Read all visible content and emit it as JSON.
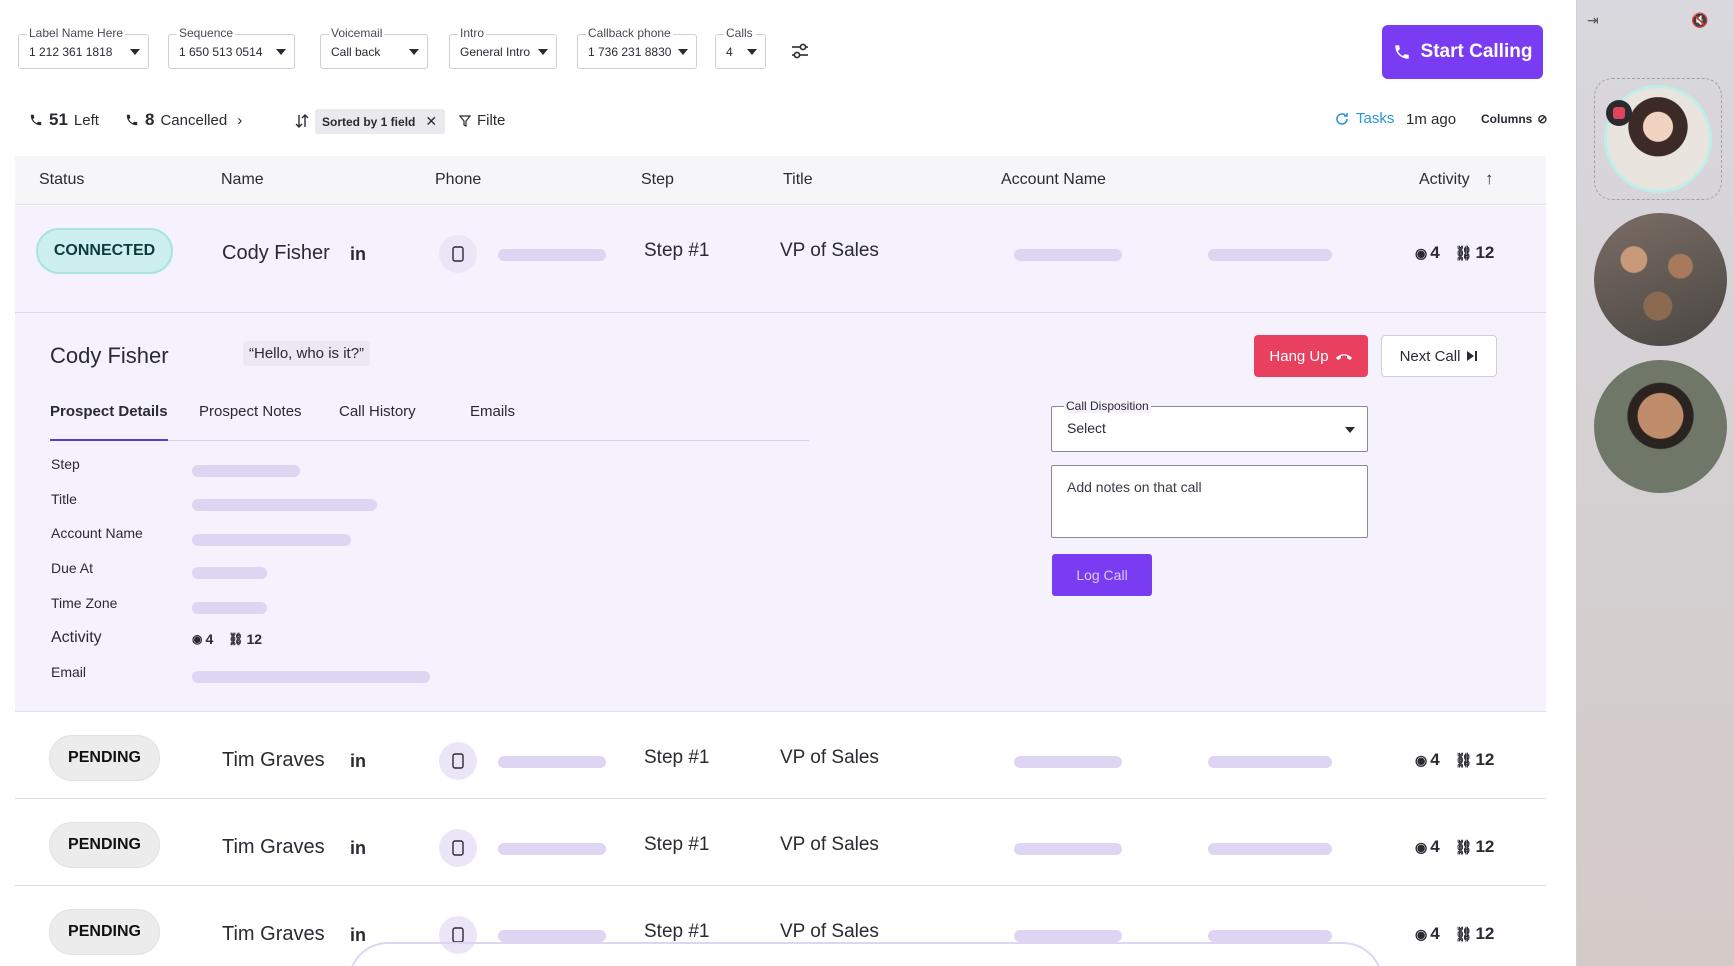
{
  "filters": [
    {
      "label": "Label Name Here",
      "value": "1 212 361 1818"
    },
    {
      "label": "Sequence",
      "value": "1 650 513 0514"
    },
    {
      "label": "Voicemail",
      "value": "Call back"
    },
    {
      "label": "Intro",
      "value": "General Intro"
    },
    {
      "label": "Callback phone",
      "value": "1 736 231 8830"
    },
    {
      "label": "Calls",
      "value": "4"
    }
  ],
  "start_button": "Start Calling",
  "stats": {
    "left_count": "51",
    "left_label": "Left",
    "cancelled_count": "8",
    "cancelled_label": "Cancelled",
    "sort_chip": "Sorted by 1 field",
    "filter_label": "Filte",
    "tasks_label": "Tasks",
    "updated": "1m ago",
    "columns_label": "Columns"
  },
  "table": {
    "headers": [
      "Status",
      "Name",
      "Phone",
      "Step",
      "Title",
      "Account Name",
      "Activity"
    ],
    "rows": [
      {
        "status": "CONNECTED",
        "name": "Cody Fisher",
        "linkedin": "in",
        "step": "Step #1",
        "title": "VP of Sales",
        "views": "4",
        "links": "12"
      },
      {
        "status": "PENDING",
        "name": "Tim Graves",
        "linkedin": "in",
        "step": "Step #1",
        "title": "VP of Sales",
        "views": "4",
        "links": "12"
      },
      {
        "status": "PENDING",
        "name": "Tim Graves",
        "linkedin": "in",
        "step": "Step #1",
        "title": "VP of Sales",
        "views": "4",
        "links": "12"
      },
      {
        "status": "PENDING",
        "name": "Tim Graves",
        "linkedin": "in",
        "step": "Step #1",
        "title": "VP of Sales",
        "views": "4",
        "links": "12"
      }
    ]
  },
  "detail": {
    "name": "Cody Fisher",
    "quote": "“Hello, who is it?”",
    "hang_up": "Hang Up",
    "next_call": "Next Call",
    "tabs": [
      "Prospect Details",
      "Prospect Notes",
      "Call History",
      "Emails"
    ],
    "fields": [
      "Step",
      "Title",
      "Account Name",
      "Due At",
      "Time Zone",
      "Activity",
      "Email"
    ],
    "activity_views": "4",
    "activity_links": "12",
    "disposition_label": "Call Disposition",
    "disposition_value": "Select",
    "notes_placeholder": "Add notes on that call",
    "log_call": "Log Call"
  },
  "colors": {
    "primary": "#7a3cf2",
    "hangup": "#ea4060",
    "connected": "#cdeff0",
    "tasks": "#2c96d8"
  }
}
